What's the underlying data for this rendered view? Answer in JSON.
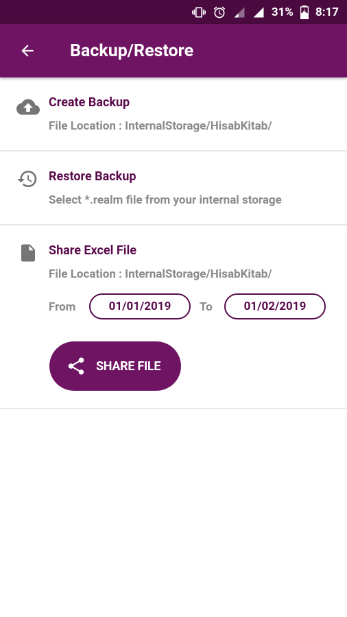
{
  "status_bar": {
    "battery": "31%",
    "time": "8:17"
  },
  "app_bar": {
    "title": "Backup/Restore"
  },
  "create_backup": {
    "title": "Create Backup",
    "subtitle": "File Location : InternalStorage/HisabKitab/"
  },
  "restore_backup": {
    "title": "Restore Backup",
    "subtitle": "Select *.realm file from your internal storage"
  },
  "share_excel": {
    "title": "Share Excel File",
    "subtitle": "File Location : InternalStorage/HisabKitab/",
    "from_label": "From",
    "from_date": "01/01/2019",
    "to_label": "To",
    "to_date": "01/02/2019",
    "share_button": "SHARE FILE"
  },
  "colors": {
    "primary": "#6e1462",
    "status_bar": "#4a0a3f",
    "accent_text": "#5a0c4c",
    "secondary_text": "#8a8a8a"
  }
}
